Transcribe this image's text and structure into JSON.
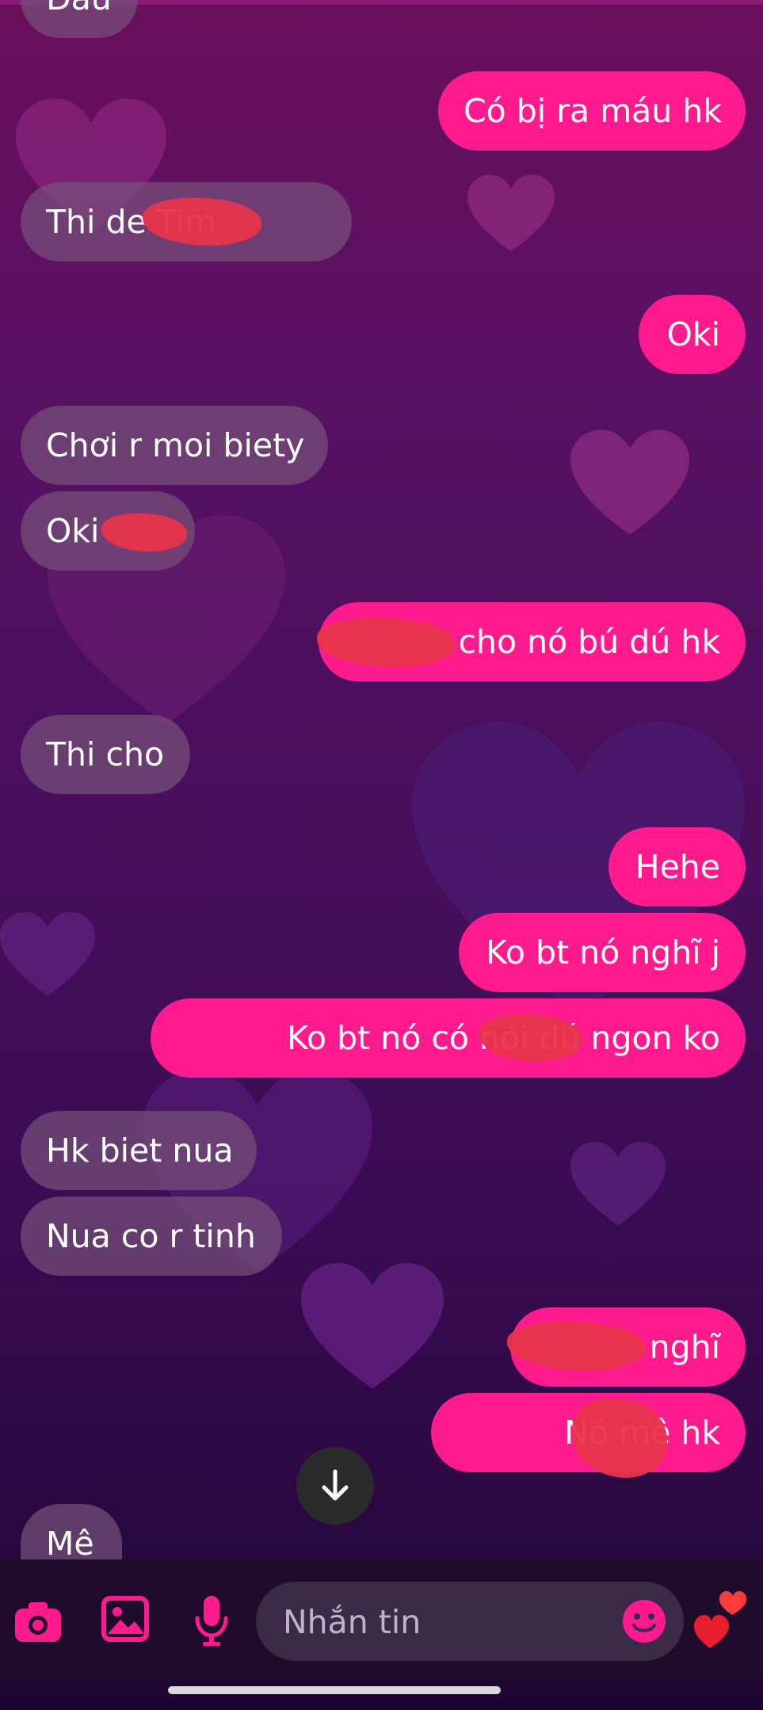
{
  "messages": [
    {
      "side": "in",
      "text": "Đâu"
    },
    {
      "side": "out",
      "text": "Có bị ra máu hk"
    },
    {
      "side": "in",
      "text": "Thi de            Tim"
    },
    {
      "side": "out",
      "text": "Oki"
    },
    {
      "side": "in",
      "text": "Chơi r moi biety"
    },
    {
      "side": "in",
      "text": "Oki"
    },
    {
      "side": "out",
      "text": "cho nó bú dú hk"
    },
    {
      "side": "in",
      "text": "Thi cho"
    },
    {
      "side": "out",
      "text": "Hehe"
    },
    {
      "side": "out",
      "text": "Ko bt nó nghĩ j"
    },
    {
      "side": "out",
      "text": "Ko bt nó có nói dú              ngon ko"
    },
    {
      "side": "in",
      "text": "Hk biet nua"
    },
    {
      "side": "in",
      "text": "Nua co r tinh"
    },
    {
      "side": "out",
      "text": "nghĩ"
    },
    {
      "side": "out",
      "text": "Nó mê              hk"
    },
    {
      "side": "in",
      "text": "Mê"
    }
  ],
  "composer": {
    "placeholder": "Nhắn tin",
    "icons": [
      "camera-icon",
      "image-icon",
      "microphone-icon",
      "emoji-icon",
      "hearts-icon"
    ]
  },
  "scroll_down_icon": "arrow-down-icon",
  "colors": {
    "outgoing": "#ff1a8e",
    "incoming": "#765078",
    "composer": "#3b2a48"
  }
}
